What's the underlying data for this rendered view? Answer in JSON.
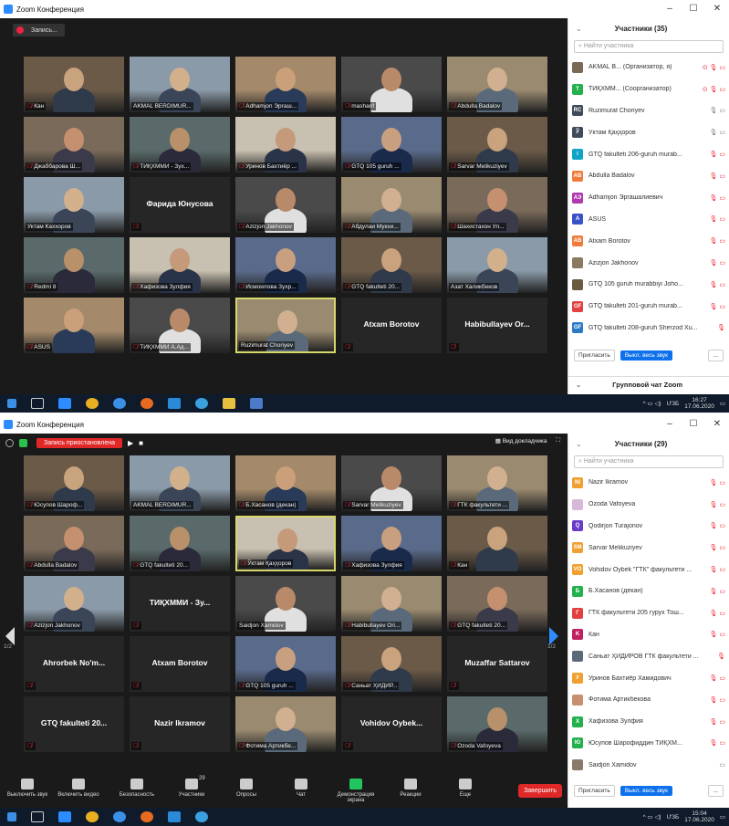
{
  "app_title": "Zoom Конференция",
  "window_controls": [
    "–",
    "☐",
    "✕"
  ],
  "top": {
    "record_label": "Запись...",
    "participants_header": "Участники (35)",
    "search_placeholder": "Найти участника",
    "tiles": [
      {
        "name": "Кан",
        "muted": true
      },
      {
        "name": "AKMAL BERDIMUR...",
        "muted": false
      },
      {
        "name": "Adhamjon Эргаш...",
        "muted": true
      },
      {
        "name": "masharif",
        "muted": true
      },
      {
        "name": "Abdulla Badalov",
        "muted": true
      },
      {
        "name": "Джаббарова Ш...",
        "muted": true
      },
      {
        "name": "ТИҚХММИ - Зух...",
        "muted": true
      },
      {
        "name": "Уринов Бахтиёр ...",
        "muted": true
      },
      {
        "name": "GTQ 105 guruh ...",
        "muted": true
      },
      {
        "name": "Sarvar Melikuziyev",
        "muted": true
      },
      {
        "name": "Уктам Каххоров",
        "muted": false
      },
      {
        "name": "Фарида Юнусова",
        "muted": true,
        "center": true
      },
      {
        "name": "Azizjon Jakhonov",
        "muted": true
      },
      {
        "name": "Абдулаи Мукхи...",
        "muted": true
      },
      {
        "name": "Шахистахон Ул...",
        "muted": true
      },
      {
        "name": "Redmi 8",
        "muted": true
      },
      {
        "name": "Хафизова Зулфия",
        "muted": true
      },
      {
        "name": "Исмоилова Зухр...",
        "muted": true
      },
      {
        "name": "GTQ fakulteti 20...",
        "muted": true
      },
      {
        "name": "Азат Халикбеков",
        "muted": false
      },
      {
        "name": "ASUS",
        "muted": true
      },
      {
        "name": "ТИҚХММИ А.Ад...",
        "muted": true
      },
      {
        "name": "Ruzimurat Choriyev",
        "muted": false,
        "active": true
      },
      {
        "name": "Atxam Borotov",
        "muted": true,
        "center": true
      },
      {
        "name": "Habibullayev Or...",
        "muted": true,
        "center": true
      }
    ],
    "participants": [
      {
        "initials": "",
        "color": "#7a6a55",
        "name": "AKMAL B... (Организатор, я)",
        "icons": "⊙ 🎙 ▭",
        "red": true
      },
      {
        "initials": "T",
        "color": "#22b14c",
        "name": "ТИҚХММ... (Соорганизатор)",
        "icons": "⊙ 🎙 ▭",
        "red": true
      },
      {
        "initials": "RC",
        "color": "#3f4a5a",
        "name": "Ruzimurat Choriyev",
        "icons": "🎙 ▭",
        "red": false
      },
      {
        "initials": "Ў",
        "color": "#3f4a5a",
        "name": "Ўктам Қаҳҳоров",
        "icons": "🎙 ▭",
        "red": false
      },
      {
        "initials": "i",
        "color": "#0fa3c8",
        "name": "GTQ fakulteti 206-guruh murab...",
        "icons": "🎙 ▭",
        "red": true
      },
      {
        "initials": "AB",
        "color": "#f07a3a",
        "name": "Abdulla Badalov",
        "icons": "🎙 ▭",
        "red": true
      },
      {
        "initials": "AЭ",
        "color": "#b03ab0",
        "name": "Adhamjon Эргашалиевич",
        "icons": "🎙 ▭",
        "red": true
      },
      {
        "initials": "A",
        "color": "#3a52c8",
        "name": "ASUS",
        "icons": "🎙 ▭",
        "red": true
      },
      {
        "initials": "AB",
        "color": "#f07a3a",
        "name": "Atxam Borotov",
        "icons": "🎙 ▭",
        "red": true
      },
      {
        "initials": "",
        "color": "#8a7a60",
        "name": "Azizjon Jakhonov",
        "icons": "🎙 ▭",
        "red": true
      },
      {
        "initials": "",
        "color": "#6a5a40",
        "name": "GTQ 105 guruh murabbiyi Joho...",
        "icons": "🎙 ▭",
        "red": true
      },
      {
        "initials": "GF",
        "color": "#e04040",
        "name": "GTQ fakulteti 201-guruh murab...",
        "icons": "🎙 ▭",
        "red": true
      },
      {
        "initials": "GF",
        "color": "#2a7ac8",
        "name": "GTQ fakulteti 208-guruh Sherzod Xu...",
        "icons": "🎙",
        "red": true
      }
    ],
    "invite": "Пригласить",
    "mute_all": "Выкл. весь звук",
    "more": "...",
    "chat_header": "Групповой чат Zoom",
    "tray_lang": "ƯЗБ",
    "time": "16:27",
    "date": "17.06.2020"
  },
  "bottom": {
    "recording_paused": "Запись приостановлена",
    "speaker_view": "Вид докладчика",
    "participants_header": "Участники (29)",
    "search_placeholder": "Найти участника",
    "page_left": "1/2",
    "page_right": "1/2",
    "tiles": [
      {
        "name": "Юсупов Шароф...",
        "muted": true
      },
      {
        "name": "AKMAL BERDIMUR...",
        "muted": false
      },
      {
        "name": "Б.Хасанов (декан)",
        "muted": true
      },
      {
        "name": "Sarvar Melikuziyev",
        "muted": true
      },
      {
        "name": "ГТК факультети ...",
        "muted": true
      },
      {
        "name": "Abdulla Badalov",
        "muted": true
      },
      {
        "name": "GTQ fakulteti 20...",
        "muted": true
      },
      {
        "name": "Ўктам Қаҳҳоров",
        "muted": true,
        "active": true
      },
      {
        "name": "Хафизова Зулфия",
        "muted": true
      },
      {
        "name": "Кан",
        "muted": true
      },
      {
        "name": "Azizjon Jakhonov",
        "muted": true
      },
      {
        "name": "ТИҚХММИ - Зу...",
        "muted": true,
        "center": true
      },
      {
        "name": "Saidjon Xamidov",
        "muted": false
      },
      {
        "name": "Habibullayev Ori...",
        "muted": true
      },
      {
        "name": "GTQ fakulteti 20...",
        "muted": true
      },
      {
        "name": "Ahrorbek No'm...",
        "muted": true,
        "center": true
      },
      {
        "name": "Atxam Borotov",
        "muted": true,
        "center": true
      },
      {
        "name": "GTQ 105 guruh ...",
        "muted": true
      },
      {
        "name": "Саньат ҲИДИР...",
        "muted": true
      },
      {
        "name": "Muzaffar Sattarov",
        "muted": true,
        "center": true
      },
      {
        "name": "GTQ fakulteti 20...",
        "muted": true,
        "center": true
      },
      {
        "name": "Nazir Ikramov",
        "muted": true,
        "center": true
      },
      {
        "name": "Фотима Артикбе...",
        "muted": true
      },
      {
        "name": "Vohidov Oybek...",
        "muted": true,
        "center": true
      },
      {
        "name": "Ozoda Vafoyeva",
        "muted": true
      }
    ],
    "participants": [
      {
        "initials": "NI",
        "color": "#f0a030",
        "name": "Nazir Ikramov",
        "icons": "🎙 ▭",
        "red": true
      },
      {
        "initials": "",
        "color": "#d8b8d8",
        "name": "Ozoda Vafoyeva",
        "icons": "🎙 ▭",
        "red": true
      },
      {
        "initials": "Q",
        "color": "#6a3ac8",
        "name": "Qodirjon Turajonov",
        "icons": "🎙 ▭",
        "red": true
      },
      {
        "initials": "SM",
        "color": "#f0a030",
        "name": "Sarvar Melikuziyev",
        "icons": "🎙 ▭",
        "red": true
      },
      {
        "initials": "VO",
        "color": "#f0a030",
        "name": "Vohidov Oybek \"ГТК\" факультети ...",
        "icons": "🎙 ▭",
        "red": true
      },
      {
        "initials": "Б",
        "color": "#22b14c",
        "name": "Б.Хасанов (декан)",
        "icons": "🎙 ▭",
        "red": true
      },
      {
        "initials": "Г",
        "color": "#e04040",
        "name": "ГТК факультети 205 гурух Тош...",
        "icons": "🎙 ▭",
        "red": true
      },
      {
        "initials": "K",
        "color": "#c02060",
        "name": "Кан",
        "icons": "🎙 ▭",
        "red": true
      },
      {
        "initials": "",
        "color": "#5a6a7a",
        "name": "Саньат ҲИДИРОВ ГТК факультети ...",
        "icons": "🎙",
        "red": true
      },
      {
        "initials": "У",
        "color": "#f0a030",
        "name": "Уринов Бахтиёр Хамидович",
        "icons": "🎙 ▭",
        "red": true
      },
      {
        "initials": "",
        "color": "#c89070",
        "name": "Фотима Артикбекова",
        "icons": "🎙 ▭",
        "red": true
      },
      {
        "initials": "X",
        "color": "#22b14c",
        "name": "Хафизова Зулфия",
        "icons": "🎙 ▭",
        "red": true
      },
      {
        "initials": "Ю",
        "color": "#22b14c",
        "name": "Юсупов Шарофиддин ТИҚХМ...",
        "icons": "🎙 ▭",
        "red": true
      },
      {
        "initials": "",
        "color": "#8a7a6a",
        "name": "Saidjon Xamidov",
        "icons": "▭",
        "red": false
      }
    ],
    "invite": "Пригласить",
    "mute_all": "Выкл. весь звук",
    "more": "...",
    "toolbar": [
      {
        "label": "Выключить звук",
        "name": "mute-button"
      },
      {
        "label": "Включить видео",
        "name": "video-button"
      },
      {
        "label": "Безопасность",
        "name": "security-button"
      },
      {
        "label": "Участники",
        "name": "participants-button",
        "badge": "29"
      },
      {
        "label": "Опросы",
        "name": "polls-button"
      },
      {
        "label": "Чат",
        "name": "chat-button"
      },
      {
        "label": "Демонстрация экрана",
        "name": "share-screen-button"
      },
      {
        "label": "Реакции",
        "name": "reactions-button"
      },
      {
        "label": "Еще",
        "name": "more-button"
      }
    ],
    "end_button": "Завершить",
    "tray_lang": "ƯЗБ",
    "time": "15:04",
    "date": "17.06.2020"
  }
}
